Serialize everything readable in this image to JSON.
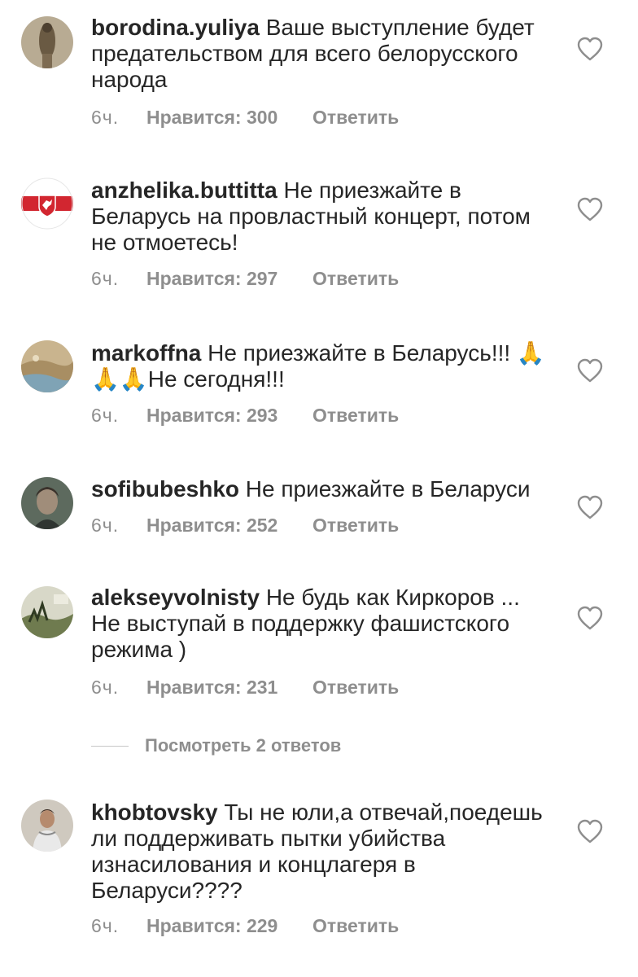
{
  "comments": [
    {
      "username": "borodina.yuliya",
      "text": "Ваше выступление будет предательством для всего белорусского народа",
      "time": "6ч.",
      "likes_label": "Нравится: 300",
      "reply_label": "Ответить",
      "avatar": "statue-photo-avatar"
    },
    {
      "username": "anzhelika.buttitta",
      "text": "Не приезжайте в Беларусь на провластный концерт, потом не отмоетесь!",
      "time": "6ч.",
      "likes_label": "Нравится: 297",
      "reply_label": "Ответить",
      "avatar": "white-red-white-flag-pahonia-avatar"
    },
    {
      "username": "markoffna",
      "text": "Не приезжайте в Беларусь!!! 🙏🙏🙏Не сегодня!!!",
      "time": "6ч.",
      "likes_label": "Нравится: 293",
      "reply_label": "Ответить",
      "avatar": "seaside-photo-avatar"
    },
    {
      "username": "sofibubeshko",
      "text": "Не приезжайте в Беларуси",
      "time": "6ч.",
      "likes_label": "Нравится: 252",
      "reply_label": "Ответить",
      "avatar": "portrait-photo-avatar"
    },
    {
      "username": "alekseyvolnisty",
      "text": "Не будь как Киркоров ... Не выступай в поддержку фашистского режима )",
      "time": "6ч.",
      "likes_label": "Нравится: 231",
      "reply_label": "Ответить",
      "avatar": "landscape-photo-avatar"
    },
    {
      "username": "khobtovsky",
      "text": "Ты не юли,а отвечай,поедешь ли поддерживать пытки убийства изнасилования и концлагеря в Беларуси????",
      "time": "6ч.",
      "likes_label": "Нравится: 229",
      "reply_label": "Ответить",
      "avatar": "man-portrait-avatar"
    }
  ],
  "view_replies_label": "Посмотреть 2 ответов",
  "icons": {
    "like": "heart-outline-icon"
  },
  "colors": {
    "text": "#262626",
    "secondary": "#8e8e8e",
    "flag_red": "#d22630"
  }
}
